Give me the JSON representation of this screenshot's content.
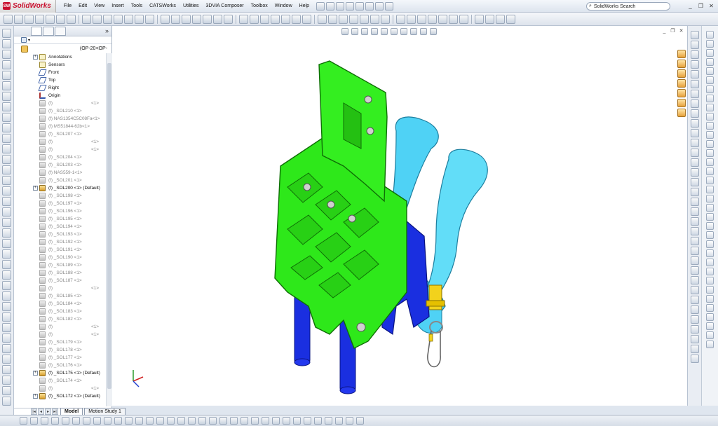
{
  "app": {
    "logo_text": "SolidWorks",
    "logo_mark": "SW"
  },
  "menu": [
    "File",
    "Edit",
    "View",
    "Insert",
    "Tools",
    "CATSWorks",
    "Utilities",
    "3DVIA Composer",
    "Toolbox",
    "Window",
    "Help"
  ],
  "search": {
    "placeholder": "SolidWorks Search"
  },
  "window_controls": {
    "minimize": "_",
    "restore": "❐",
    "close": "✕"
  },
  "feature_tree": {
    "root_label": "(OP-20<OP-",
    "items": [
      {
        "label": "Annotations",
        "suffix": "",
        "icon": "annotations-icon",
        "kind": "sys",
        "expandable": true
      },
      {
        "label": "Sensors",
        "suffix": "",
        "icon": "sensors-icon",
        "kind": "sys",
        "expandable": false
      },
      {
        "label": "Front",
        "suffix": "",
        "icon": "plane-icon",
        "kind": "plane",
        "expandable": false
      },
      {
        "label": "Top",
        "suffix": "",
        "icon": "plane-icon",
        "kind": "plane",
        "expandable": false
      },
      {
        "label": "Right",
        "suffix": "",
        "icon": "plane-icon",
        "kind": "plane",
        "expandable": false
      },
      {
        "label": "Origin",
        "suffix": "",
        "icon": "origin-icon",
        "kind": "origin",
        "expandable": false
      },
      {
        "label": "(f)",
        "suffix": "<1>",
        "icon": "part-icon",
        "kind": "part",
        "expandable": false
      },
      {
        "label": "(f) _SOL210 <1>",
        "suffix": "",
        "icon": "part-icon",
        "kind": "part",
        "expandable": false
      },
      {
        "label": "(f) NAS1354C5C08Fa<1>",
        "suffix": "",
        "icon": "part-icon",
        "kind": "part",
        "expandable": false
      },
      {
        "label": "(f) MS51844-62b<1>",
        "suffix": "",
        "icon": "part-icon",
        "kind": "part",
        "expandable": false
      },
      {
        "label": "(f) _SOL207 <1>",
        "suffix": "",
        "icon": "part-icon",
        "kind": "part",
        "expandable": false
      },
      {
        "label": "(f)",
        "suffix": "<1>",
        "icon": "part-icon",
        "kind": "part",
        "expandable": false
      },
      {
        "label": "(f)",
        "suffix": "<1>",
        "icon": "part-icon",
        "kind": "part",
        "expandable": false
      },
      {
        "label": "(f) _SOL204 <1>",
        "suffix": "",
        "icon": "part-icon",
        "kind": "part",
        "expandable": false
      },
      {
        "label": "(f) _SOL203 <1>",
        "suffix": "",
        "icon": "part-icon",
        "kind": "part",
        "expandable": false
      },
      {
        "label": "(f) NAS559-1<1>",
        "suffix": "",
        "icon": "part-icon",
        "kind": "part",
        "expandable": false
      },
      {
        "label": "(f) _SOL201 <1>",
        "suffix": "",
        "icon": "part-icon",
        "kind": "part",
        "expandable": false
      },
      {
        "label": "(f) _SOL200 <1> (Default)",
        "suffix": "",
        "icon": "assembly-icon",
        "kind": "asm",
        "expandable": true
      },
      {
        "label": "(f) _SOL198 <1>",
        "suffix": "",
        "icon": "part-icon",
        "kind": "part",
        "expandable": false
      },
      {
        "label": "(f) _SOL197 <1>",
        "suffix": "",
        "icon": "part-icon",
        "kind": "part",
        "expandable": false
      },
      {
        "label": "(f) _SOL196 <1>",
        "suffix": "",
        "icon": "part-icon",
        "kind": "part",
        "expandable": false
      },
      {
        "label": "(f) _SOL195 <1>",
        "suffix": "",
        "icon": "part-icon",
        "kind": "part",
        "expandable": false
      },
      {
        "label": "(f) _SOL194 <1>",
        "suffix": "",
        "icon": "part-icon",
        "kind": "part",
        "expandable": false
      },
      {
        "label": "(f) _SOL193 <1>",
        "suffix": "",
        "icon": "part-icon",
        "kind": "part",
        "expandable": false
      },
      {
        "label": "(f) _SOL192 <1>",
        "suffix": "",
        "icon": "part-icon",
        "kind": "part",
        "expandable": false
      },
      {
        "label": "(f) _SOL191 <1>",
        "suffix": "",
        "icon": "part-icon",
        "kind": "part",
        "expandable": false
      },
      {
        "label": "(f) _SOL190 <1>",
        "suffix": "",
        "icon": "part-icon",
        "kind": "part",
        "expandable": false
      },
      {
        "label": "(f) _SOL189 <1>",
        "suffix": "",
        "icon": "part-icon",
        "kind": "part",
        "expandable": false
      },
      {
        "label": "(f) _SOL188 <1>",
        "suffix": "",
        "icon": "part-icon",
        "kind": "part",
        "expandable": false
      },
      {
        "label": "(f) _SOL187 <1>",
        "suffix": "",
        "icon": "part-icon",
        "kind": "part",
        "expandable": false
      },
      {
        "label": "(f)",
        "suffix": "<1>",
        "icon": "part-icon",
        "kind": "part",
        "expandable": false
      },
      {
        "label": "(f) _SOL185 <1>",
        "suffix": "",
        "icon": "part-icon",
        "kind": "part",
        "expandable": false
      },
      {
        "label": "(f) _SOL184 <1>",
        "suffix": "",
        "icon": "part-icon",
        "kind": "part",
        "expandable": false
      },
      {
        "label": "(f) _SOL183 <1>",
        "suffix": "",
        "icon": "part-icon",
        "kind": "part",
        "expandable": false
      },
      {
        "label": "(f) _SOL182 <1>",
        "suffix": "",
        "icon": "part-icon",
        "kind": "part",
        "expandable": false
      },
      {
        "label": "(f)",
        "suffix": "<1>",
        "icon": "part-icon",
        "kind": "part",
        "expandable": false
      },
      {
        "label": "(f)",
        "suffix": "<1>",
        "icon": "part-icon",
        "kind": "part",
        "expandable": false
      },
      {
        "label": "(f) _SOL179 <1>",
        "suffix": "",
        "icon": "part-icon",
        "kind": "part",
        "expandable": false
      },
      {
        "label": "(f) _SOL178 <1>",
        "suffix": "",
        "icon": "part-icon",
        "kind": "part",
        "expandable": false
      },
      {
        "label": "(f) _SOL177 <1>",
        "suffix": "",
        "icon": "part-icon",
        "kind": "part",
        "expandable": false
      },
      {
        "label": "(f) _SOL176 <1>",
        "suffix": "",
        "icon": "part-icon",
        "kind": "part",
        "expandable": false
      },
      {
        "label": "(f) _SOL175 <1> (Default)",
        "suffix": "",
        "icon": "assembly-icon",
        "kind": "asm",
        "expandable": true
      },
      {
        "label": "(f) _SOL174 <1>",
        "suffix": "",
        "icon": "part-icon",
        "kind": "part",
        "expandable": false
      },
      {
        "label": "(f)",
        "suffix": "<1>",
        "icon": "part-icon",
        "kind": "part",
        "expandable": false
      },
      {
        "label": "(f) _SOL172 <1> (Default)",
        "suffix": "",
        "icon": "assembly-icon",
        "kind": "asm",
        "expandable": true
      }
    ]
  },
  "bottom_tabs": [
    {
      "label": "Model",
      "active": true
    },
    {
      "label": "Motion Study 1",
      "active": false
    }
  ],
  "colors": {
    "part_green": "#2ee81a",
    "part_blue": "#1a2fe0",
    "part_cyan": "#4fd2f5",
    "part_yellow": "#f2d21c"
  }
}
